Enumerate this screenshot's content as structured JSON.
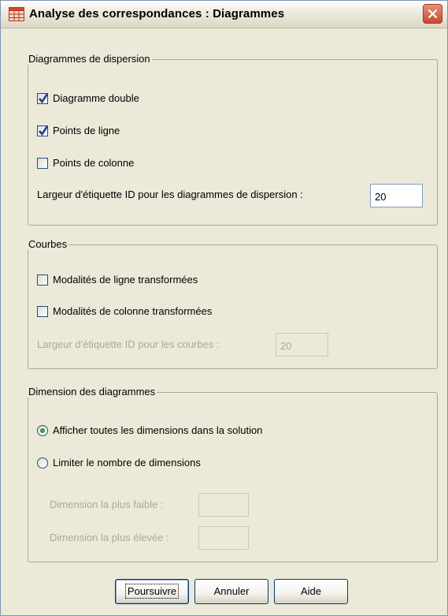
{
  "window": {
    "title": "Analyse des correspondances : Diagrammes"
  },
  "icons": {
    "app": "table-icon",
    "close": "close-icon"
  },
  "scatter_group": {
    "title": "Diagrammes de dispersion",
    "biplot_label": "Diagramme double",
    "biplot_checked": true,
    "row_points_label": "Points de ligne",
    "row_points_checked": true,
    "column_points_label": "Points de colonne",
    "column_points_checked": false,
    "id_width_label": "Largeur d'étiquette ID pour les diagrammes de dispersion :",
    "id_width_value": "20"
  },
  "curves_group": {
    "title": "Courbes",
    "row_categories_label": "Modalités de ligne transformées",
    "row_categories_checked": false,
    "column_categories_label": "Modalités de colonne transformées",
    "column_categories_checked": false,
    "id_width_label": "Largeur d'étiquette ID pour les courbes :",
    "id_width_value": "20"
  },
  "dimension_group": {
    "title": "Dimension des diagrammes",
    "show_all_label": "Afficher toutes les dimensions dans la solution",
    "show_all_selected": true,
    "restrict_label": "Limiter le nombre de dimensions",
    "restrict_selected": false,
    "lowest_label": "Dimension la plus faible :",
    "lowest_value": "",
    "highest_label": "Dimension la plus élevée :",
    "highest_value": ""
  },
  "buttons": {
    "continue": "Poursuivre",
    "cancel": "Annuler",
    "help": "Aide"
  }
}
